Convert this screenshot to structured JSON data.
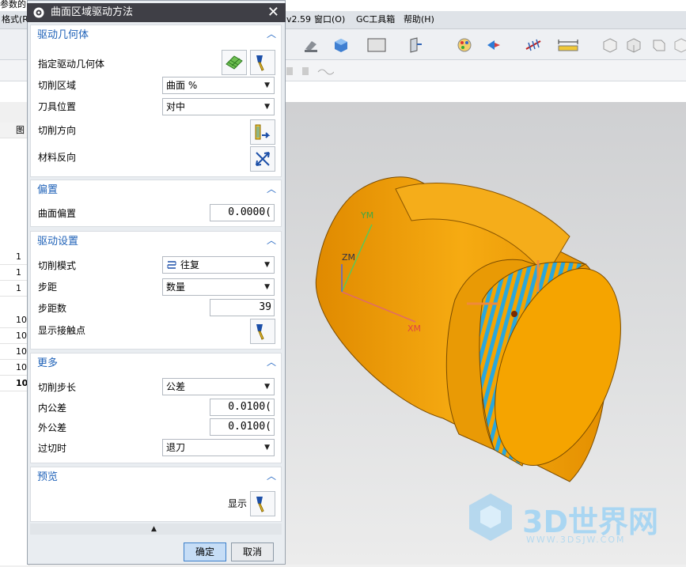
{
  "topline": {
    "text": "参数的"
  },
  "menubar": {
    "items": [
      "格式(R)",
      "v2.59",
      "窗口(O)",
      "GC工具箱",
      "帮助(H)"
    ]
  },
  "leftgrid": {
    "header": "图",
    "rows": [
      "1",
      "1",
      "1",
      "10",
      "10",
      "10",
      "10",
      "10"
    ]
  },
  "dialog": {
    "title": "曲面区域驱动方法",
    "groups": {
      "drive_geometry": {
        "title": "驱动几何体",
        "specify_label": "指定驱动几何体",
        "cut_area_label": "切削区域",
        "cut_area_value": "曲面 %",
        "tool_position_label": "刀具位置",
        "tool_position_value": "对中",
        "cut_direction_label": "切削方向",
        "material_reverse_label": "材料反向"
      },
      "offset": {
        "title": "偏置",
        "surface_offset_label": "曲面偏置",
        "surface_offset_value": "0.0000("
      },
      "drive_settings": {
        "title": "驱动设置",
        "cut_mode_label": "切削模式",
        "cut_mode_value": "往复",
        "stepover_label": "步距",
        "stepover_value": "数量",
        "step_count_label": "步距数",
        "step_count_value": "39",
        "show_contact_label": "显示接触点"
      },
      "more": {
        "title": "更多",
        "cut_step_label": "切削步长",
        "cut_step_value": "公差",
        "intol_label": "内公差",
        "intol_value": "0.0100(",
        "outtol_label": "外公差",
        "outtol_value": "0.0100(",
        "overcut_label": "过切时",
        "overcut_value": "退刀"
      },
      "preview": {
        "title": "预览",
        "show_label": "显示"
      }
    },
    "ok_label": "确定",
    "cancel_label": "取消"
  },
  "viewport": {
    "axis_xm": "XM",
    "axis_ym": "YM",
    "axis_zm": "ZM"
  },
  "watermark": {
    "brand": "3D世界网",
    "url": "WWW.3DSJW.COM"
  },
  "colors": {
    "part": "#f5a400",
    "stripe": "#2aa7dc",
    "title_bar": "#3f3f46",
    "group_title": "#1f62b8"
  }
}
